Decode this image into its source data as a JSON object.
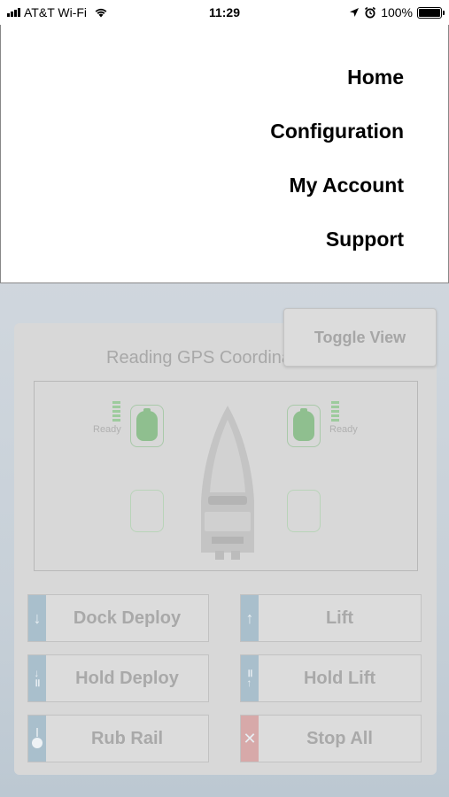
{
  "status_bar": {
    "carrier": "AT&T Wi-Fi",
    "time": "11:29",
    "battery_percent": "100%"
  },
  "menu": {
    "items": [
      "Home",
      "Configuration",
      "My Account",
      "Support"
    ]
  },
  "app": {
    "gps_status": "Reading GPS Coordinates",
    "toggle_view_label": "Toggle View",
    "left_pod_status": "Ready",
    "right_pod_status": "Ready",
    "buttons": {
      "dock_deploy": "Dock Deploy",
      "lift": "Lift",
      "hold_deploy": "Hold Deploy",
      "hold_lift": "Hold Lift",
      "rub_rail": "Rub Rail",
      "stop_all": "Stop All"
    }
  },
  "colors": {
    "strip_blue": "#a9bfcc",
    "strip_red": "#d7a9a9",
    "pod_green": "#8fbf8f"
  }
}
